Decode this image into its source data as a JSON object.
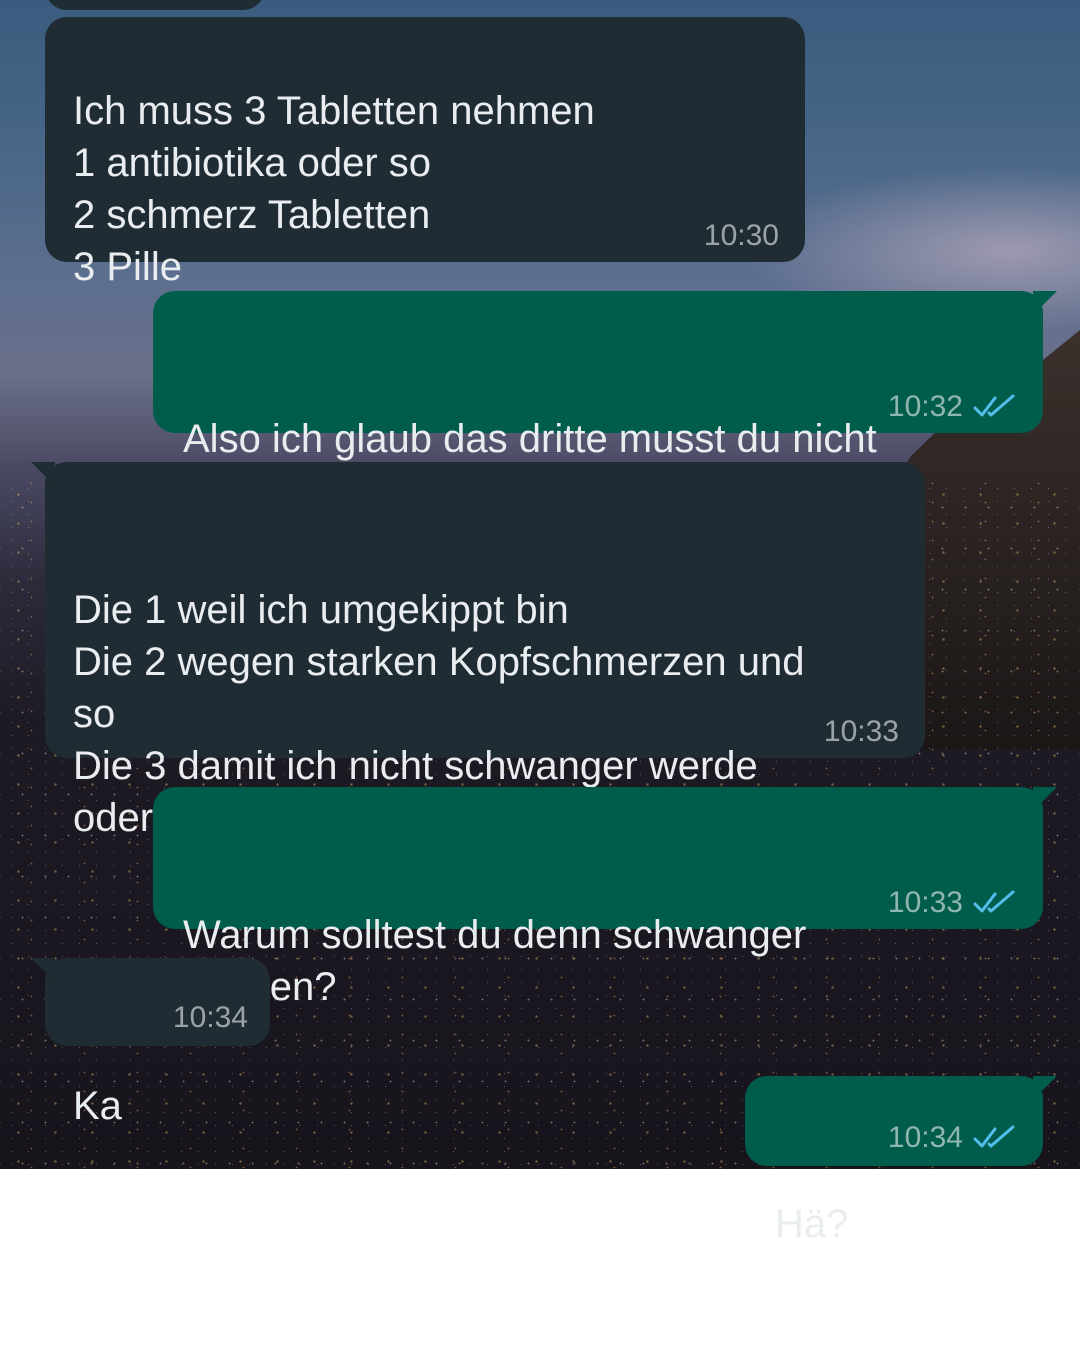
{
  "messages": [
    {
      "direction": "incoming",
      "text": "Ich muss 3 Tabletten nehmen\n1 antibiotika oder so\n2 schmerz Tabletten\n3 Pille",
      "time": "10:30"
    },
    {
      "direction": "outgoing",
      "text": "Also ich glaub das dritte musst du nicht\nnehmen aber der Rest?",
      "time": "10:32",
      "status": "read"
    },
    {
      "direction": "incoming",
      "text": "Die 1 weil ich umgekippt bin\nDie 2 wegen starken Kopfschmerzen und\nso\nDie 3 damit ich nicht schwanger werde\noder so",
      "time": "10:33"
    },
    {
      "direction": "outgoing",
      "text": "Warum solltest du denn schwanger\nwerden?",
      "time": "10:33",
      "status": "read"
    },
    {
      "direction": "incoming",
      "text": "Ka",
      "time": "10:34"
    },
    {
      "direction": "outgoing",
      "text": "Hä?",
      "time": "10:34",
      "status": "read"
    }
  ],
  "colors": {
    "incoming_bubble": "#202c33",
    "outgoing_bubble": "#005c4b",
    "read_ticks": "#53bdeb",
    "text": "#e9edef"
  },
  "icons": {
    "read_receipt": "double-check-icon"
  }
}
